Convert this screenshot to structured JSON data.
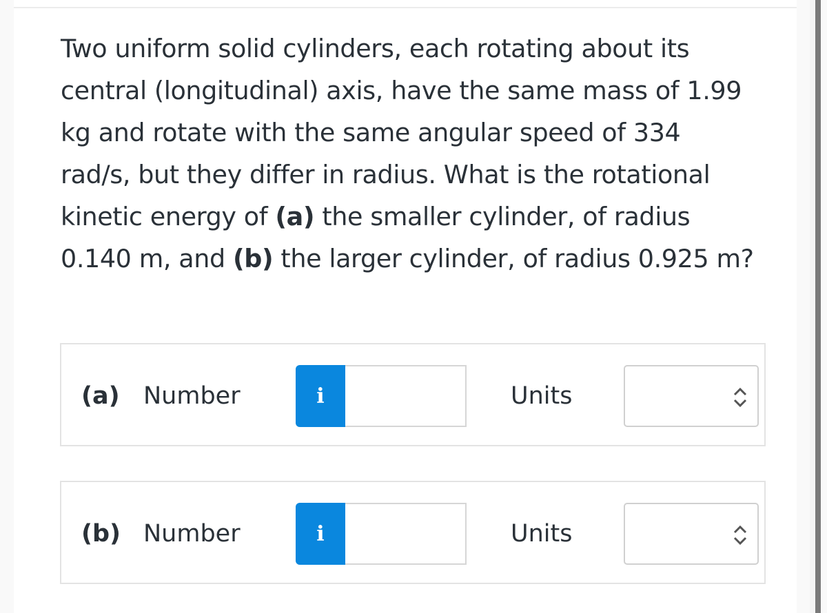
{
  "question": {
    "segments": [
      {
        "text": "Two uniform solid cylinders, each rotating about its central (longitudinal) axis, have the same mass of 1.99 kg and rotate with the same angular speed of 334 rad/s, but they differ in radius. What is the rotational kinetic energy of ",
        "bold": false
      },
      {
        "text": "(a)",
        "bold": true
      },
      {
        "text": " the smaller cylinder, of radius 0.140 m, and ",
        "bold": false
      },
      {
        "text": "(b)",
        "bold": true
      },
      {
        "text": " the larger cylinder, of radius 0.925 m?",
        "bold": false
      }
    ]
  },
  "parts": [
    {
      "label": "(a)",
      "number_label": "Number",
      "info_icon": "i",
      "number_value": "",
      "units_label": "Units",
      "units_value": ""
    },
    {
      "label": "(b)",
      "number_label": "Number",
      "info_icon": "i",
      "number_value": "",
      "units_label": "Units",
      "units_value": ""
    }
  ],
  "colors": {
    "accent": "#0a87de",
    "text": "#2a3138",
    "border": "#e3e3e3"
  }
}
